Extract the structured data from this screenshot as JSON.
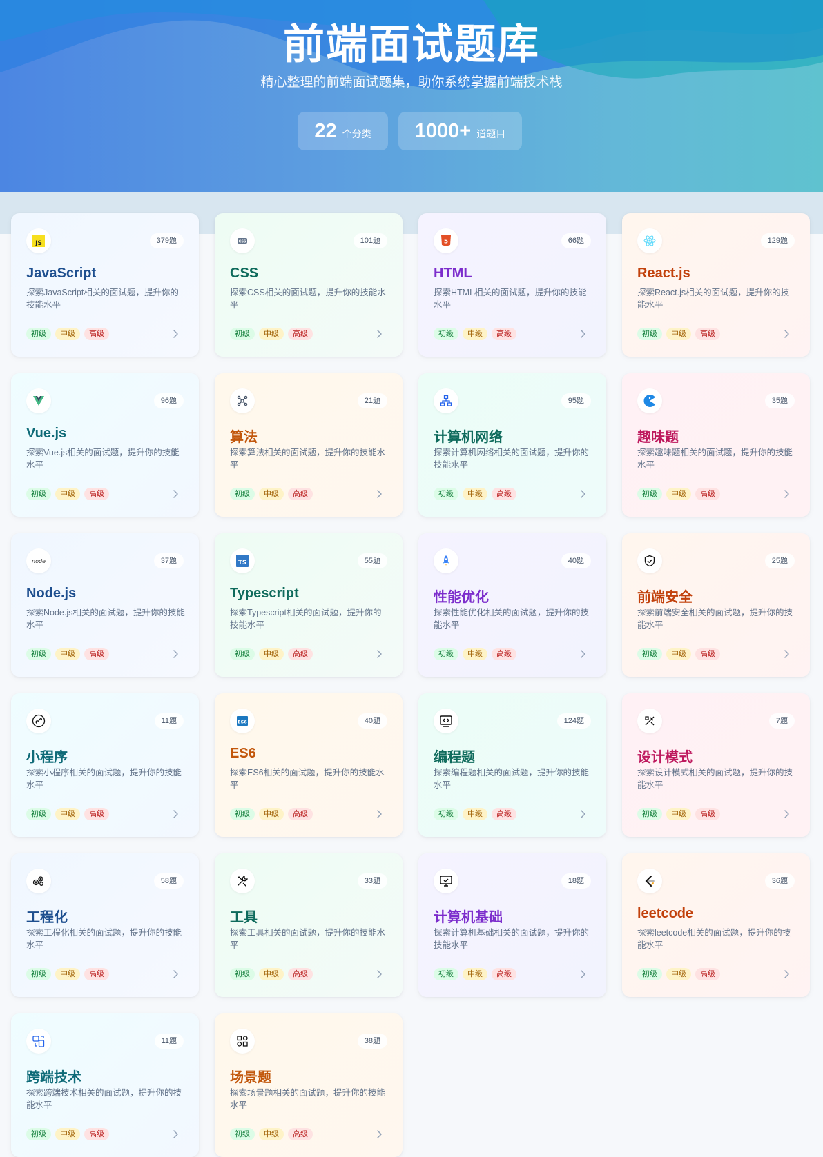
{
  "header": {
    "title": "前端面试题库",
    "subtitle": "精心整理的前端面试题集，助你系统掌握前端技术栈",
    "stats": [
      {
        "value": "22",
        "unit": "个分类"
      },
      {
        "value": "1000+",
        "unit": "道题目"
      }
    ]
  },
  "level_labels": {
    "beginner": "初级",
    "intermediate": "中级",
    "advanced": "高级"
  },
  "categories": [
    {
      "name": "JavaScript",
      "count": "379题",
      "desc": "探索JavaScript相关的面试题，提升你的技能水平",
      "icon": "javascript-icon",
      "title_color": "#1e4f8f",
      "theme": "blue"
    },
    {
      "name": "CSS",
      "count": "101题",
      "desc": "探索CSS相关的面试题，提升你的技能水平",
      "icon": "css-icon",
      "title_color": "#0f6b5c",
      "theme": "green"
    },
    {
      "name": "HTML",
      "count": "66题",
      "desc": "探索HTML相关的面试题，提升你的技能水平",
      "icon": "html5-icon",
      "title_color": "#7c2dcc",
      "theme": "purple"
    },
    {
      "name": "React.js",
      "count": "129题",
      "desc": "探索React.js相关的面试题，提升你的技能水平",
      "icon": "react-icon",
      "title_color": "#c2410c",
      "theme": "orange"
    },
    {
      "name": "Vue.js",
      "count": "96题",
      "desc": "探索Vue.js相关的面试题，提升你的技能水平",
      "icon": "vue-icon",
      "title_color": "#0f6b78",
      "theme": "teal"
    },
    {
      "name": "算法",
      "count": "21题",
      "desc": "探索算法相关的面试题，提升你的技能水平",
      "icon": "algorithm-icon",
      "title_color": "#c2570c",
      "theme": "peach"
    },
    {
      "name": "计算机网络",
      "count": "95题",
      "desc": "探索计算机网络相关的面试题，提升你的技能水平",
      "icon": "network-icon",
      "title_color": "#0f6b5c",
      "theme": "mint"
    },
    {
      "name": "趣味题",
      "count": "35题",
      "desc": "探索趣味题相关的面试题，提升你的技能水平",
      "icon": "pacman-icon",
      "title_color": "#be185d",
      "theme": "pink"
    },
    {
      "name": "Node.js",
      "count": "37题",
      "desc": "探索Node.js相关的面试题，提升你的技能水平",
      "icon": "nodejs-icon",
      "title_color": "#1e4f8f",
      "theme": "blue"
    },
    {
      "name": "Typescript",
      "count": "55题",
      "desc": "探索Typescript相关的面试题，提升你的技能水平",
      "icon": "typescript-icon",
      "title_color": "#0f6b5c",
      "theme": "green"
    },
    {
      "name": "性能优化",
      "count": "40题",
      "desc": "探索性能优化相关的面试题，提升你的技能水平",
      "icon": "rocket-icon",
      "title_color": "#7c2dcc",
      "theme": "purple"
    },
    {
      "name": "前端安全",
      "count": "25题",
      "desc": "探索前端安全相关的面试题，提升你的技能水平",
      "icon": "shield-icon",
      "title_color": "#c2410c",
      "theme": "orange"
    },
    {
      "name": "小程序",
      "count": "11题",
      "desc": "探索小程序相关的面试题，提升你的技能水平",
      "icon": "miniprogram-icon",
      "title_color": "#0f6b78",
      "theme": "teal"
    },
    {
      "name": "ES6",
      "count": "40题",
      "desc": "探索ES6相关的面试题，提升你的技能水平",
      "icon": "es6-icon",
      "title_color": "#c2570c",
      "theme": "peach"
    },
    {
      "name": "编程题",
      "count": "124题",
      "desc": "探索编程题相关的面试题，提升你的技能水平",
      "icon": "code-icon",
      "title_color": "#0f6b5c",
      "theme": "mint"
    },
    {
      "name": "设计模式",
      "count": "7题",
      "desc": "探索设计模式相关的面试题，提升你的技能水平",
      "icon": "design-tools-icon",
      "title_color": "#be185d",
      "theme": "pink"
    },
    {
      "name": "工程化",
      "count": "58题",
      "desc": "探索工程化相关的面试题，提升你的技能水平",
      "icon": "engineering-icon",
      "title_color": "#1e4f8f",
      "theme": "blue"
    },
    {
      "name": "工具",
      "count": "33题",
      "desc": "探索工具相关的面试题，提升你的技能水平",
      "icon": "tools-icon",
      "title_color": "#0f6b5c",
      "theme": "green"
    },
    {
      "name": "计算机基础",
      "count": "18题",
      "desc": "探索计算机基础相关的面试题，提升你的技能水平",
      "icon": "computer-icon",
      "title_color": "#7c2dcc",
      "theme": "purple"
    },
    {
      "name": "leetcode",
      "count": "36题",
      "desc": "探索leetcode相关的面试题，提升你的技能水平",
      "icon": "leetcode-icon",
      "title_color": "#c2410c",
      "theme": "orange"
    },
    {
      "name": "跨端技术",
      "count": "11题",
      "desc": "探索跨端技术相关的面试题，提升你的技能水平",
      "icon": "cross-platform-icon",
      "title_color": "#0f6b78",
      "theme": "teal"
    },
    {
      "name": "场景题",
      "count": "38题",
      "desc": "探索场景题相关的面试题，提升你的技能水平",
      "icon": "scenario-icon",
      "title_color": "#c2570c",
      "theme": "peach"
    }
  ]
}
